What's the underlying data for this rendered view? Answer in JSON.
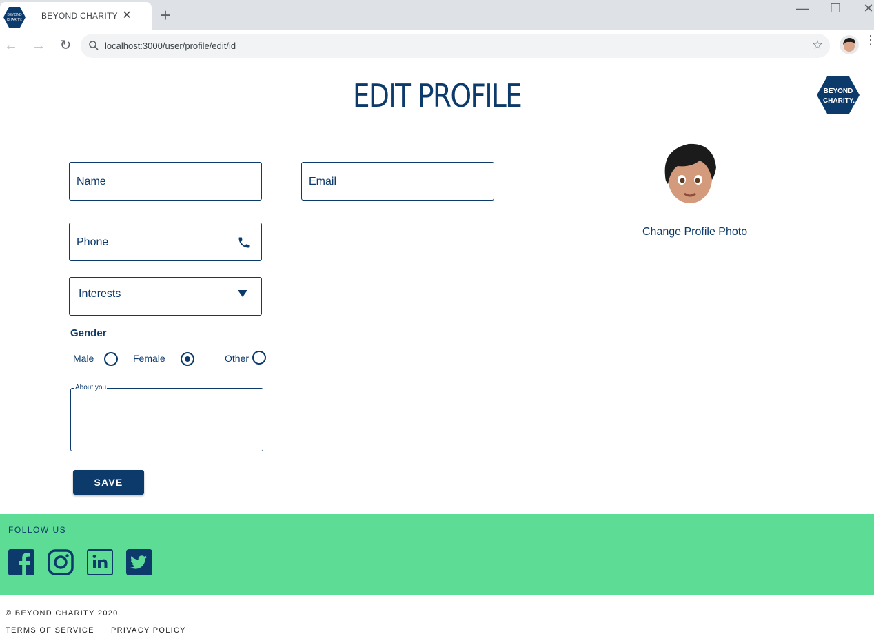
{
  "browser": {
    "tab_title": "BEYOND CHARITY",
    "tab_close": "✕",
    "new_tab": "+",
    "url": "localhost:3000/user/profile/edit/id",
    "favicon_text_line1": "BEYOND",
    "favicon_text_line2": "CHARITY."
  },
  "page": {
    "title": "EDIT PROFILE",
    "logo_line1": "BEYOND",
    "logo_line2": "CHARITY."
  },
  "form": {
    "name_placeholder": "Name",
    "email_placeholder": "Email",
    "phone_placeholder": "Phone",
    "interests_label": "Interests",
    "gender_heading": "Gender",
    "gender_options": [
      {
        "label": "Male",
        "selected": false
      },
      {
        "label": "Female",
        "selected": true
      },
      {
        "label": "Other",
        "selected": false
      }
    ],
    "about_label": "About you",
    "save_label": "SAVE"
  },
  "profile_photo": {
    "change_label": "Change Profile Photo"
  },
  "footer": {
    "follow_label": "FOLLOW US",
    "social_icons": [
      "facebook-icon",
      "instagram-icon",
      "linkedin-icon",
      "twitter-icon"
    ],
    "copyright": "© BEYOND CHARITY 2020",
    "terms": "TERMS OF SERVICE",
    "privacy": "PRIVACY POLICY"
  },
  "colors": {
    "brand_navy": "#0c3a6b",
    "footer_green": "#5cdc94",
    "tabbar_bg": "#dee1e6"
  }
}
